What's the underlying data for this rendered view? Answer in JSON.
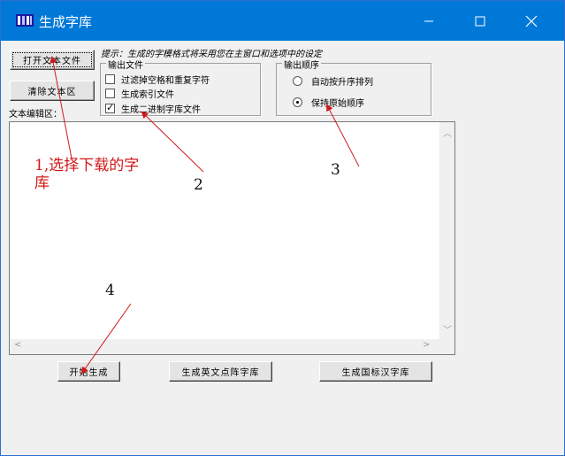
{
  "window": {
    "title": "生成字库",
    "controls": {
      "minimize": "—",
      "maximize": "☐",
      "close": "✕"
    }
  },
  "toolbar": {
    "open_button": "打开文本文件",
    "clear_button": "清除文本区",
    "hint": "提示：生成的字模格式将采用您在主窗口和选项中的设定"
  },
  "output_file": {
    "legend": "输出文件",
    "options": [
      {
        "label": "过滤掉空格和重复字符",
        "checked": false
      },
      {
        "label": "生成索引文件",
        "checked": false
      },
      {
        "label": "生成二进制字库文件",
        "checked": true
      }
    ]
  },
  "output_order": {
    "legend": "输出顺序",
    "options": [
      {
        "label": "自动按升序排列",
        "selected": false
      },
      {
        "label": "保持原始顺序",
        "selected": true
      }
    ]
  },
  "editor": {
    "label": "文本编辑区：",
    "content": ""
  },
  "actions": {
    "start": "开始生成",
    "ascii_font": "生成英文点阵字库",
    "gb_font": "生成国标汉字库"
  },
  "annotations": {
    "note1_line1": "1,选择下载的字",
    "note1_line2": "库",
    "n2": "2",
    "n3": "3",
    "n4": "4",
    "color": "#d01818"
  }
}
